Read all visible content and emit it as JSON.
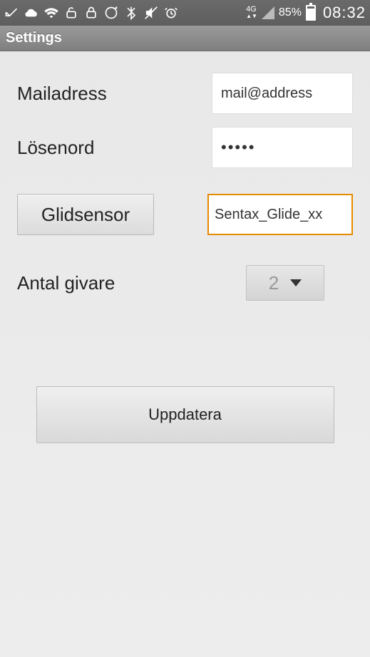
{
  "status": {
    "battery_pct": "85%",
    "clock": "08:32",
    "network": "4G"
  },
  "appbar": {
    "title": "Settings"
  },
  "form": {
    "email_label": "Mailadress",
    "email_value": "mail@address",
    "password_label": "Lösenord",
    "password_value": "•••••",
    "glidsensor_button": "Glidsensor",
    "glidsensor_value": "Sentax_Glide_xx",
    "givare_label": "Antal givare",
    "givare_value": "2",
    "update_button": "Uppdatera"
  }
}
